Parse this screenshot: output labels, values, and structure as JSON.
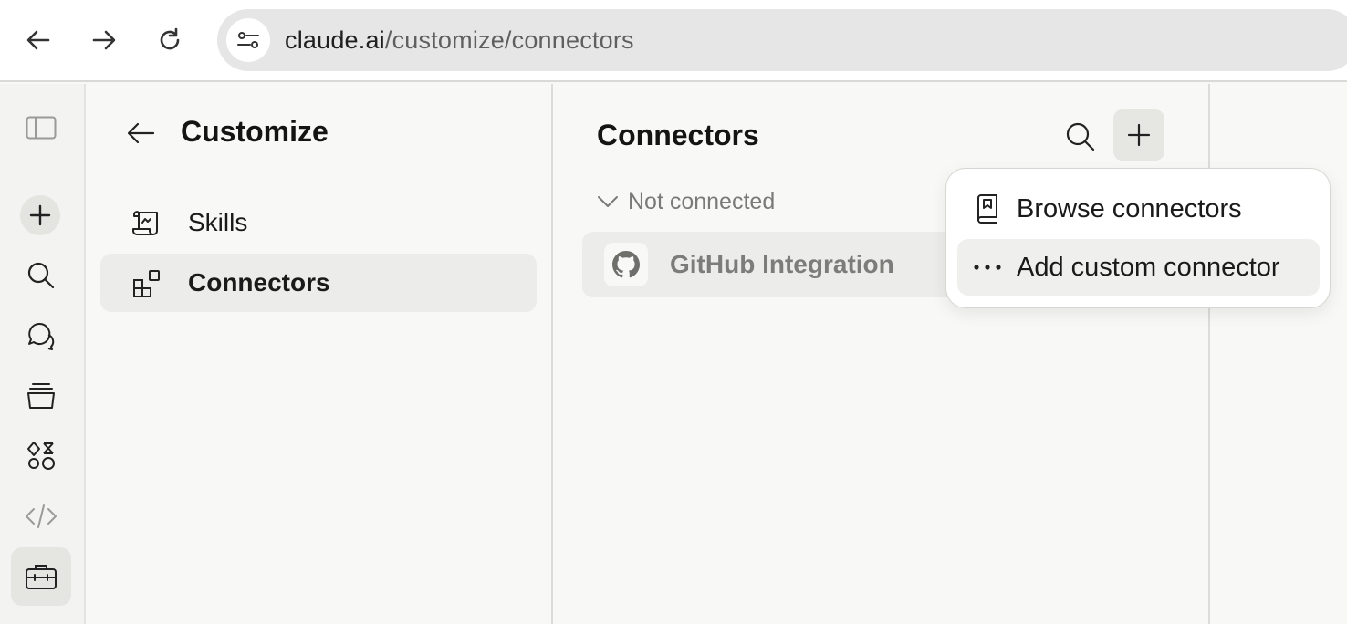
{
  "browser": {
    "url_host": "claude.ai",
    "url_path": "/customize/connectors",
    "icons": [
      "back-arrow-icon",
      "forward-arrow-icon",
      "reload-icon",
      "site-settings-icon"
    ]
  },
  "rail": {
    "icons": [
      "sidebar-toggle-icon",
      "plus-icon",
      "search-icon",
      "chats-icon",
      "projects-icon",
      "artifacts-icon",
      "code-icon",
      "toolbox-icon"
    ],
    "active": "toolbox-icon"
  },
  "customize": {
    "title": "Customize",
    "items": [
      {
        "label": "Skills",
        "icon": "scroll-icon",
        "active": false
      },
      {
        "label": "Connectors",
        "icon": "connectors-icon",
        "active": true
      }
    ]
  },
  "connectors": {
    "title": "Connectors",
    "section_label": "Not connected",
    "items": [
      {
        "name": "GitHub Integration",
        "icon": "github-icon"
      }
    ]
  },
  "dropdown": {
    "items": [
      {
        "label": "Browse connectors",
        "icon": "book-icon"
      },
      {
        "label": "Add custom connector",
        "icon": "more-dots-icon"
      }
    ]
  },
  "colors": {
    "background": "#f8f8f6",
    "rail": "#f3f3f1",
    "active_item": "#ececea",
    "text": "#1a1a1a",
    "muted": "#7a7a77"
  }
}
